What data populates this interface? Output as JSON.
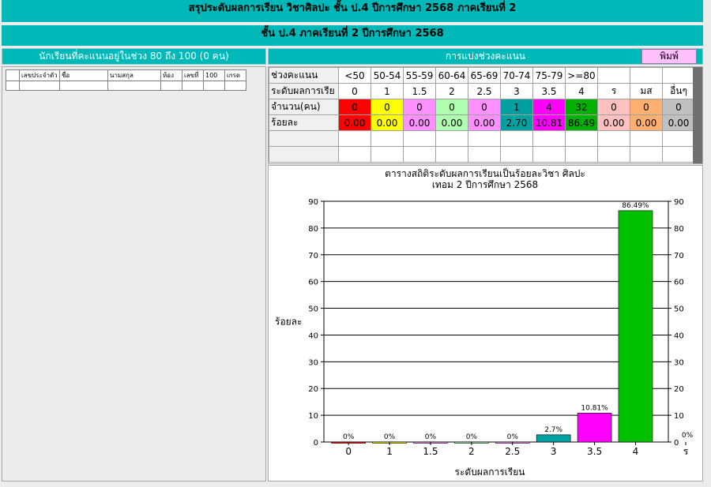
{
  "window": {
    "title_main": "สรุประดับผลการเรียน วิชาศิลปะ ชั้น ป.4  ปีการศึกษา  2568 ภาคเรียนที่  2",
    "title_sub": "ชั้น ป.4 ภาคเรียนที่  2  ปีการศึกษา  2568"
  },
  "left_panel": {
    "header": "นักเรียนที่คะแนนอยู่ในช่วง 80 ถึง 100 (0 คน)",
    "columns": [
      "เลขประจำตัว",
      "ชื่อ",
      "นามสกุล",
      "ห้อง",
      "เลขที่",
      "100",
      "เกรด"
    ]
  },
  "right_panel": {
    "header": "การแบ่งช่วงคะแนน",
    "print_label": "พิมพ์"
  },
  "stats": {
    "row_labels": [
      "ช่วงคะแนน",
      "ระดับผลการเรีย",
      "จำนวน(คน)",
      "ร้อยละ"
    ],
    "ranges": [
      "<50",
      "50-54",
      "55-59",
      "60-64",
      "65-69",
      "70-74",
      "75-79",
      ">=80",
      "",
      "",
      ""
    ],
    "grades": [
      "0",
      "1",
      "1.5",
      "2",
      "2.5",
      "3",
      "3.5",
      "4",
      "ร",
      "มส",
      "อื่นๆ"
    ],
    "counts": [
      "0",
      "0",
      "0",
      "0",
      "0",
      "1",
      "4",
      "32",
      "0",
      "0",
      "0"
    ],
    "percents": [
      "0.00",
      "0.00",
      "0.00",
      "0.00",
      "0.00",
      "2.70",
      "10.81",
      "86.49",
      "0.00",
      "0.00",
      "0.00"
    ],
    "colors": [
      "#ff0000",
      "#ffff00",
      "#ff90ff",
      "#b0ffb0",
      "#ff90ff",
      "#00a0a0",
      "#ff00ff",
      "#00b000",
      "#ffc0c0",
      "#ffb070",
      "#c0c0c0"
    ]
  },
  "chart_data": {
    "type": "bar",
    "title": "ตารางสถิติระดับผลการเรียนเป็นร้อยละวิชา ศิลปะ",
    "subtitle": "เทอม 2  ปีการศึกษา  2568",
    "xlabel": "ระดับผลการเรียน",
    "ylabel": "ร้อยละ",
    "ylim": [
      0,
      90
    ],
    "yticks": [
      0,
      10,
      20,
      30,
      40,
      50,
      60,
      70,
      80,
      90
    ],
    "categories": [
      "0",
      "1",
      "1.5",
      "2",
      "2.5",
      "3",
      "3.5",
      "4",
      "ร"
    ],
    "values": [
      0,
      0,
      0,
      0,
      0,
      2.7,
      10.81,
      86.49,
      0
    ],
    "value_labels": [
      "0%",
      "0%",
      "0%",
      "0%",
      "0%",
      "2.7%",
      "10.81%",
      "86.49%",
      "0%"
    ],
    "bar_colors": [
      "#ff0000",
      "#ffff00",
      "#ff90ff",
      "#b0ffb0",
      "#ff90ff",
      "#00a0a0",
      "#ff00ff",
      "#00c000",
      "#ffc0c0"
    ],
    "grid": true,
    "dual_y_axis": true
  }
}
